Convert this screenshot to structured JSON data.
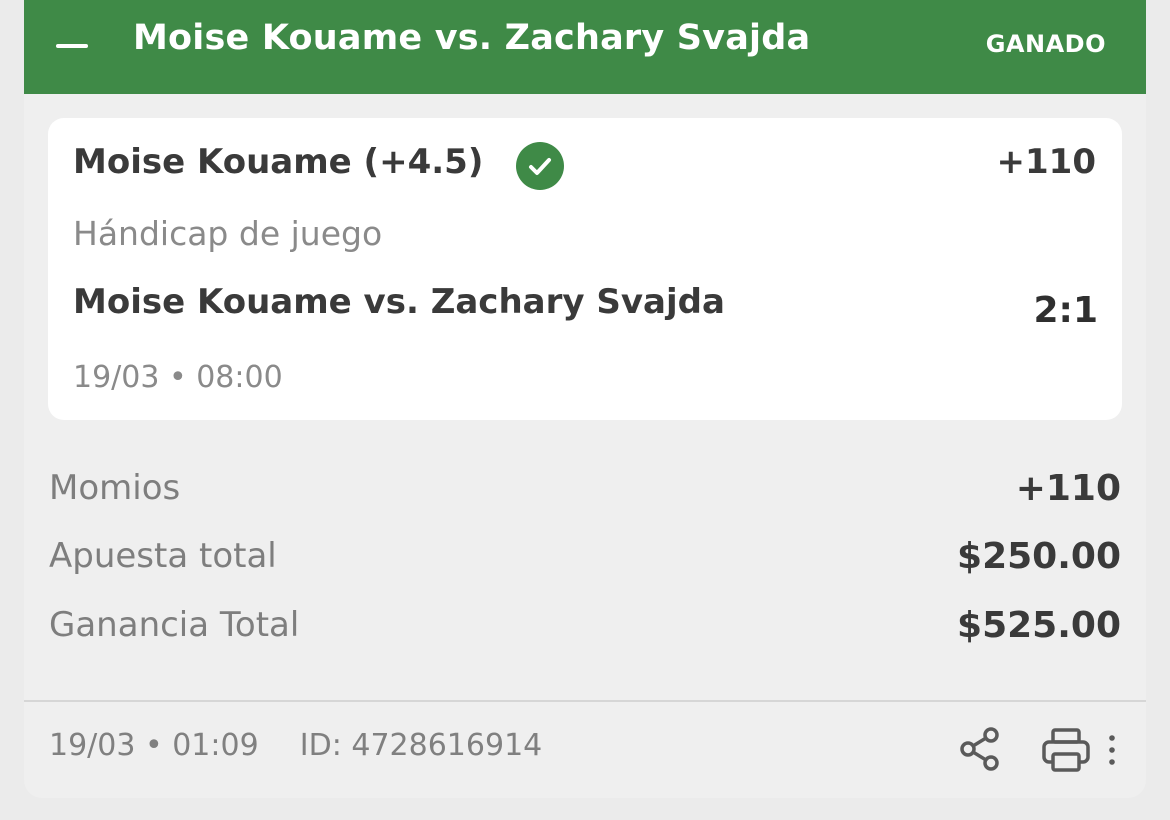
{
  "header": {
    "title": "Moise Kouame vs. Zachary Svajda",
    "status": "GANADO",
    "color": "#3f8a47"
  },
  "selection": {
    "name": "Moise Kouame (+4.5)",
    "odds": "+110",
    "market": "Hándicap de juego",
    "event": "Moise Kouame vs. Zachary Svajda",
    "score": "2:1",
    "datetime": "19/03 • 08:00",
    "status_icon": "check-circle-icon"
  },
  "summary": [
    {
      "label": "Momios",
      "value": "+110"
    },
    {
      "label": "Apuesta total",
      "value": "$250.00"
    },
    {
      "label": "Ganancia Total",
      "value": "$525.00"
    }
  ],
  "footer": {
    "datetime": "19/03 • 01:09",
    "id_text": "ID: 4728616914",
    "icons": [
      "share-icon",
      "print-icon",
      "more-vertical-icon"
    ]
  }
}
